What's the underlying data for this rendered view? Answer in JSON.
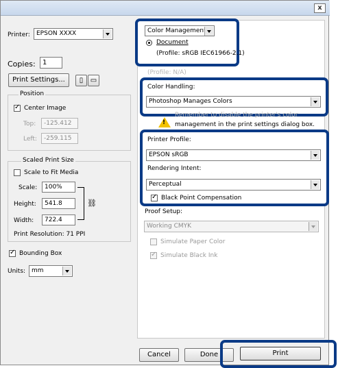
{
  "window": {
    "close_label": "x"
  },
  "printer": {
    "label": "Printer:",
    "value": "EPSON XXXX"
  },
  "copies": {
    "label": "Copies:",
    "value": "1"
  },
  "print_settings": {
    "label": "Print Settings..."
  },
  "position": {
    "title": "Position",
    "center_image": "Center Image",
    "center_image_checked": true,
    "top_label": "Top:",
    "top_value": "-125.412",
    "left_label": "Left:",
    "left_value": "-259.115"
  },
  "scaled": {
    "title": "Scaled Print Size",
    "fit_media": "Scale to Fit Media",
    "fit_media_checked": false,
    "scale_label": "Scale:",
    "scale_value": "100%",
    "height_label": "Height:",
    "height_value": "541.8",
    "width_label": "Width:",
    "width_value": "722.4",
    "resolution": "Print Resolution: 71 PPI"
  },
  "bounding_box": {
    "label": "Bounding Box",
    "checked": true
  },
  "units": {
    "label": "Units:",
    "value": "mm"
  },
  "color_management": {
    "mode": "Color Management",
    "document_label": "Document",
    "profile": "(Profile: sRGB IEC61966-2.1)",
    "ghost_text": "(Profile: N/A)"
  },
  "color_handling": {
    "label": "Color Handling:",
    "value": "Photoshop Manages Colors"
  },
  "warning": {
    "line1": "Remember to disable the printer's color",
    "line2": "management in the print settings dialog box."
  },
  "printer_profile": {
    "label": "Printer Profile:",
    "value": "EPSON sRGB"
  },
  "rendering_intent": {
    "label": "Rendering Intent:",
    "value": "Perceptual"
  },
  "black_point": {
    "label": "Black Point Compensation",
    "checked": true
  },
  "proof": {
    "label": "Proof Setup:",
    "value": "Working CMYK",
    "simulate_paper": "Simulate Paper Color",
    "simulate_paper_checked": false,
    "simulate_ink": "Simulate Black Ink",
    "simulate_ink_checked": true
  },
  "buttons": {
    "cancel": "Cancel",
    "done": "Done",
    "print": "Print"
  },
  "colors": {
    "highlight": "#0a3a86",
    "warning": "#f2c200"
  }
}
